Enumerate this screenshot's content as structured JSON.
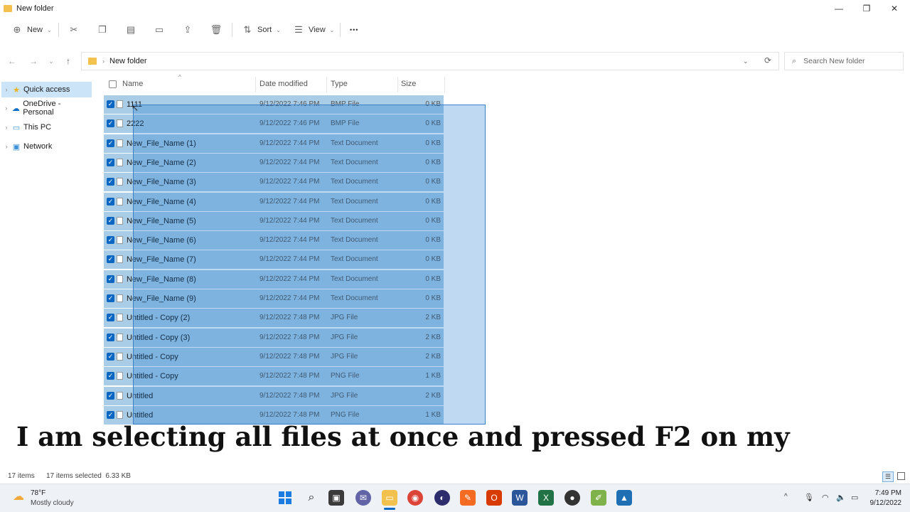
{
  "window": {
    "title": "New folder",
    "minimize": "—",
    "restore": "❐",
    "close": "✕"
  },
  "toolbar": {
    "new_label": "New",
    "sort_label": "Sort",
    "view_label": "View",
    "more_label": "•••"
  },
  "navigation": {
    "back": "←",
    "forward": "→",
    "recent": "⌄",
    "up": "↑",
    "breadcrumb": "New folder",
    "search_placeholder": "Search New folder"
  },
  "sidebar": {
    "items": [
      {
        "label": "Quick access",
        "icon": "star-icon"
      },
      {
        "label": "OneDrive - Personal",
        "icon": "cloud-icon"
      },
      {
        "label": "This PC",
        "icon": "computer-icon"
      },
      {
        "label": "Network",
        "icon": "network-icon"
      }
    ]
  },
  "columns": {
    "name": "Name",
    "date": "Date modified",
    "type": "Type",
    "size": "Size"
  },
  "files": [
    {
      "name": "1111",
      "date": "9/12/2022 7:46 PM",
      "type": "BMP File",
      "size": "0 KB"
    },
    {
      "name": "2222",
      "date": "9/12/2022 7:46 PM",
      "type": "BMP File",
      "size": "0 KB"
    },
    {
      "name": "New_File_Name (1)",
      "date": "9/12/2022 7:44 PM",
      "type": "Text Document",
      "size": "0 KB"
    },
    {
      "name": "New_File_Name (2)",
      "date": "9/12/2022 7:44 PM",
      "type": "Text Document",
      "size": "0 KB"
    },
    {
      "name": "New_File_Name (3)",
      "date": "9/12/2022 7:44 PM",
      "type": "Text Document",
      "size": "0 KB"
    },
    {
      "name": "New_File_Name (4)",
      "date": "9/12/2022 7:44 PM",
      "type": "Text Document",
      "size": "0 KB"
    },
    {
      "name": "New_File_Name (5)",
      "date": "9/12/2022 7:44 PM",
      "type": "Text Document",
      "size": "0 KB"
    },
    {
      "name": "New_File_Name (6)",
      "date": "9/12/2022 7:44 PM",
      "type": "Text Document",
      "size": "0 KB"
    },
    {
      "name": "New_File_Name (7)",
      "date": "9/12/2022 7:44 PM",
      "type": "Text Document",
      "size": "0 KB"
    },
    {
      "name": "New_File_Name (8)",
      "date": "9/12/2022 7:44 PM",
      "type": "Text Document",
      "size": "0 KB"
    },
    {
      "name": "New_File_Name (9)",
      "date": "9/12/2022 7:44 PM",
      "type": "Text Document",
      "size": "0 KB"
    },
    {
      "name": "Untitled - Copy (2)",
      "date": "9/12/2022 7:48 PM",
      "type": "JPG File",
      "size": "2 KB"
    },
    {
      "name": "Untitled - Copy (3)",
      "date": "9/12/2022 7:48 PM",
      "type": "JPG File",
      "size": "2 KB"
    },
    {
      "name": "Untitled - Copy",
      "date": "9/12/2022 7:48 PM",
      "type": "JPG File",
      "size": "2 KB"
    },
    {
      "name": "Untitled - Copy",
      "date": "9/12/2022 7:48 PM",
      "type": "PNG File",
      "size": "1 KB"
    },
    {
      "name": "Untitled",
      "date": "9/12/2022 7:48 PM",
      "type": "JPG File",
      "size": "2 KB"
    },
    {
      "name": "Untitled",
      "date": "9/12/2022 7:48 PM",
      "type": "PNG File",
      "size": "1 KB"
    }
  ],
  "caption": "I am selecting all files at once and pressed F2 on my",
  "status": {
    "items": "17 items",
    "selected": "17 items selected  6.33 KB"
  },
  "taskbar": {
    "weather_temp": "78°F",
    "weather_desc": "Mostly cloudy",
    "time": "7:49 PM",
    "date": "9/12/2022"
  },
  "colors": {
    "selection": "#a9cde6",
    "accent": "#0b67c2"
  }
}
